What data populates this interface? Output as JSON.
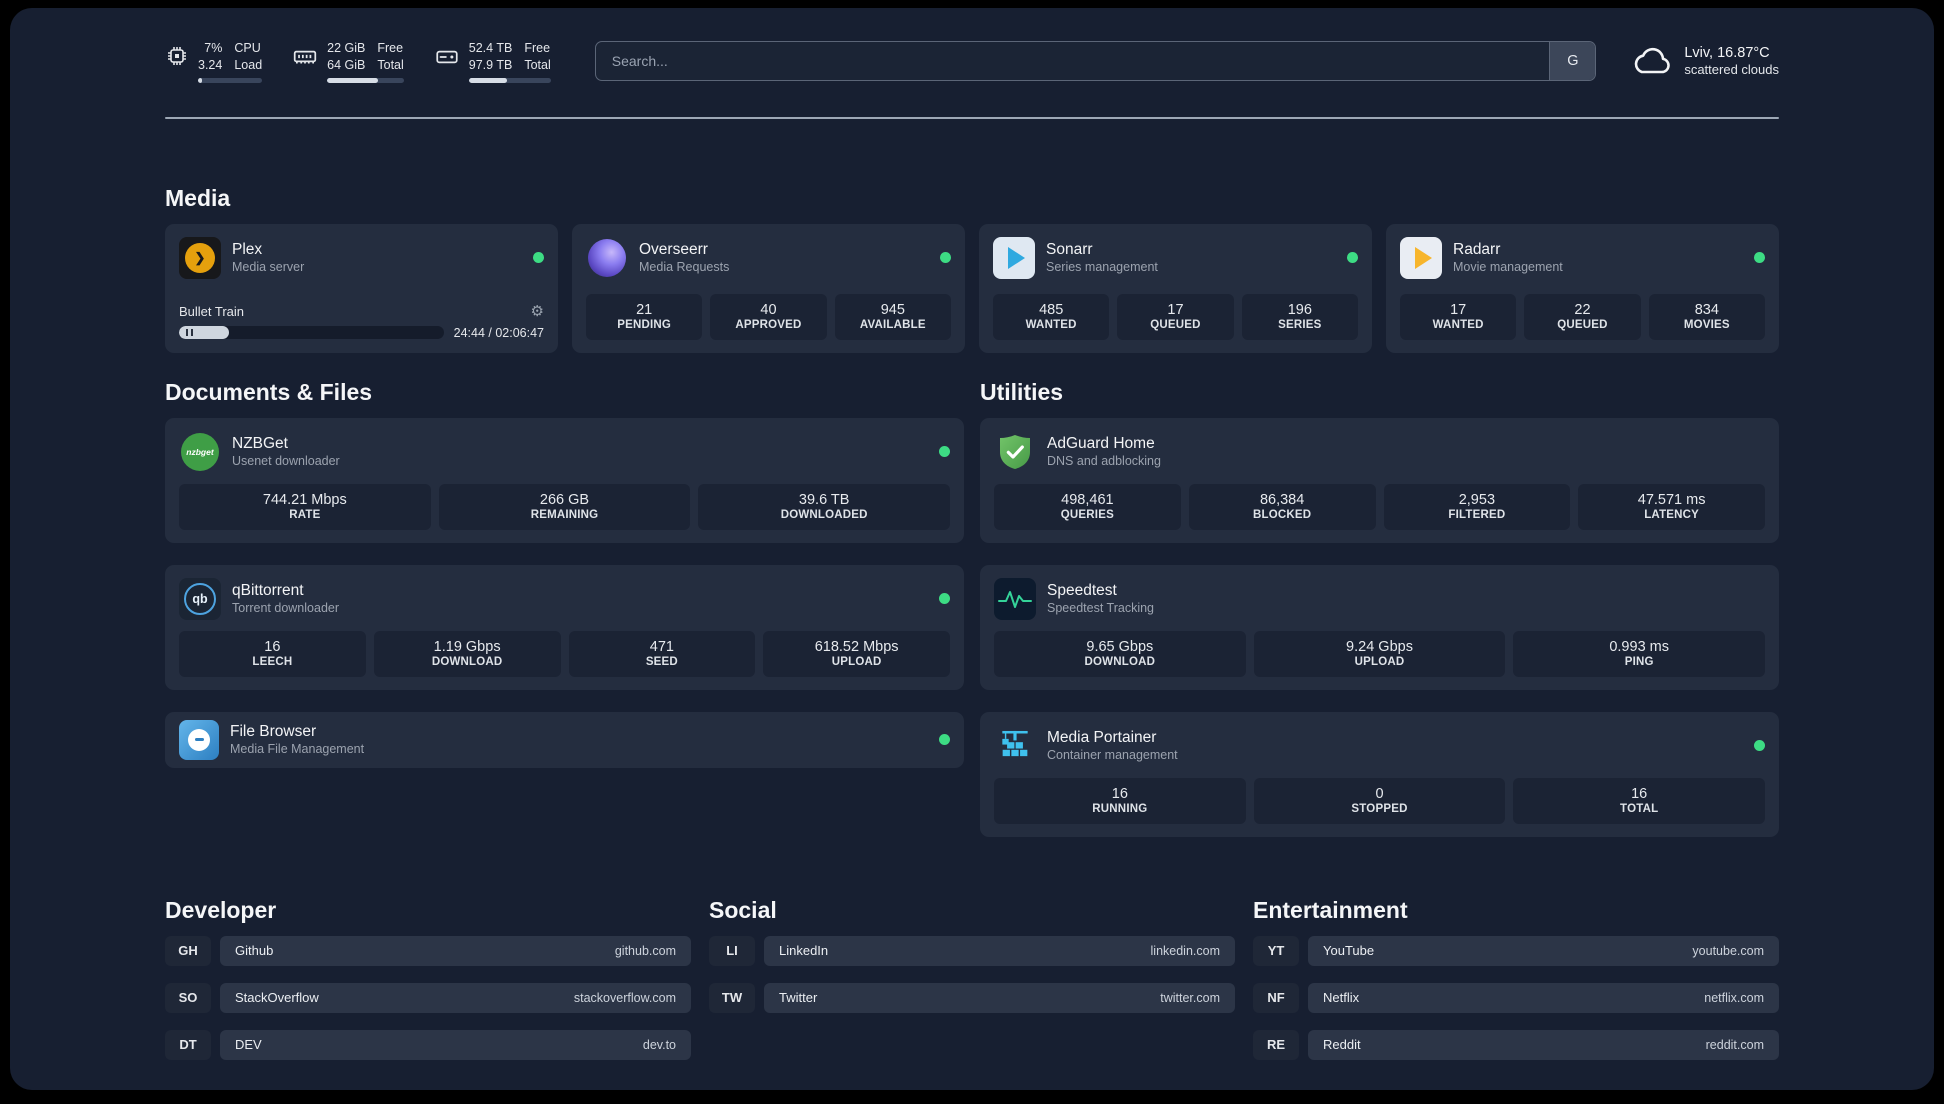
{
  "topbar": {
    "resources": [
      {
        "values": [
          "7%",
          "3.24"
        ],
        "labels": [
          "CPU",
          "Load"
        ],
        "progress": 7
      },
      {
        "values": [
          "22 GiB",
          "64 GiB"
        ],
        "labels": [
          "Free",
          "Total"
        ],
        "progress": 66
      },
      {
        "values": [
          "52.4 TB",
          "97.9 TB"
        ],
        "labels": [
          "Free",
          "Total"
        ],
        "progress": 47
      }
    ],
    "search": {
      "placeholder": "Search...",
      "provider": "G"
    },
    "weather": {
      "location": "Lviv, 16.87°C",
      "condition": "scattered clouds"
    }
  },
  "icons": {
    "plex_chevron": "❯",
    "nzbget_text": "nzbget",
    "qbittorrent_text": "qb",
    "gear": "⚙"
  },
  "colors": {
    "status_online": "#3ddc84",
    "background": "#171f31",
    "card": "#242d3f",
    "stat_tile": "#1b2334"
  },
  "groups": {
    "media": {
      "title": "Media",
      "services": [
        {
          "name": "Plex",
          "desc": "Media server",
          "status": "online",
          "widget": {
            "track": "Bullet Train",
            "time": "24:44 / 02:06:47",
            "progress": 19
          }
        },
        {
          "name": "Overseerr",
          "desc": "Media Requests",
          "status": "online",
          "stats": [
            {
              "value": "21",
              "label": "PENDING"
            },
            {
              "value": "40",
              "label": "APPROVED"
            },
            {
              "value": "945",
              "label": "AVAILABLE"
            }
          ]
        },
        {
          "name": "Sonarr",
          "desc": "Series management",
          "status": "online",
          "stats": [
            {
              "value": "485",
              "label": "WANTED"
            },
            {
              "value": "17",
              "label": "QUEUED"
            },
            {
              "value": "196",
              "label": "SERIES"
            }
          ]
        },
        {
          "name": "Radarr",
          "desc": "Movie management",
          "status": "online",
          "stats": [
            {
              "value": "17",
              "label": "WANTED"
            },
            {
              "value": "22",
              "label": "QUEUED"
            },
            {
              "value": "834",
              "label": "MOVIES"
            }
          ]
        }
      ]
    },
    "documents": {
      "title": "Documents & Files",
      "services": [
        {
          "name": "NZBGet",
          "desc": "Usenet downloader",
          "status": "online",
          "stats": [
            {
              "value": "744.21 Mbps",
              "label": "RATE"
            },
            {
              "value": "266 GB",
              "label": "REMAINING"
            },
            {
              "value": "39.6 TB",
              "label": "DOWNLOADED"
            }
          ]
        },
        {
          "name": "qBittorrent",
          "desc": "Torrent downloader",
          "status": "online",
          "stats": [
            {
              "value": "16",
              "label": "LEECH"
            },
            {
              "value": "1.19 Gbps",
              "label": "DOWNLOAD"
            },
            {
              "value": "471",
              "label": "SEED"
            },
            {
              "value": "618.52 Mbps",
              "label": "UPLOAD"
            }
          ]
        },
        {
          "name": "File Browser",
          "desc": "Media File Management",
          "status": "online"
        }
      ]
    },
    "utilities": {
      "title": "Utilities",
      "services": [
        {
          "name": "AdGuard Home",
          "desc": "DNS and adblocking",
          "stats": [
            {
              "value": "498,461",
              "label": "QUERIES"
            },
            {
              "value": "86,384",
              "label": "BLOCKED"
            },
            {
              "value": "2,953",
              "label": "FILTERED"
            },
            {
              "value": "47.571 ms",
              "label": "LATENCY"
            }
          ]
        },
        {
          "name": "Speedtest",
          "desc": "Speedtest Tracking",
          "stats": [
            {
              "value": "9.65 Gbps",
              "label": "DOWNLOAD"
            },
            {
              "value": "9.24 Gbps",
              "label": "UPLOAD"
            },
            {
              "value": "0.993 ms",
              "label": "PING"
            }
          ]
        },
        {
          "name": "Media Portainer",
          "desc": "Container management",
          "status": "online",
          "stats": [
            {
              "value": "16",
              "label": "RUNNING"
            },
            {
              "value": "0",
              "label": "STOPPED"
            },
            {
              "value": "16",
              "label": "TOTAL"
            }
          ]
        }
      ]
    }
  },
  "bookmarks": [
    {
      "title": "Developer",
      "items": [
        {
          "abbr": "GH",
          "name": "Github",
          "domain": "github.com"
        },
        {
          "abbr": "SO",
          "name": "StackOverflow",
          "domain": "stackoverflow.com"
        },
        {
          "abbr": "DT",
          "name": "DEV",
          "domain": "dev.to"
        }
      ]
    },
    {
      "title": "Social",
      "items": [
        {
          "abbr": "LI",
          "name": "LinkedIn",
          "domain": "linkedin.com"
        },
        {
          "abbr": "TW",
          "name": "Twitter",
          "domain": "twitter.com"
        }
      ]
    },
    {
      "title": "Entertainment",
      "items": [
        {
          "abbr": "YT",
          "name": "YouTube",
          "domain": "youtube.com"
        },
        {
          "abbr": "NF",
          "name": "Netflix",
          "domain": "netflix.com"
        },
        {
          "abbr": "RE",
          "name": "Reddit",
          "domain": "reddit.com"
        }
      ]
    }
  ]
}
